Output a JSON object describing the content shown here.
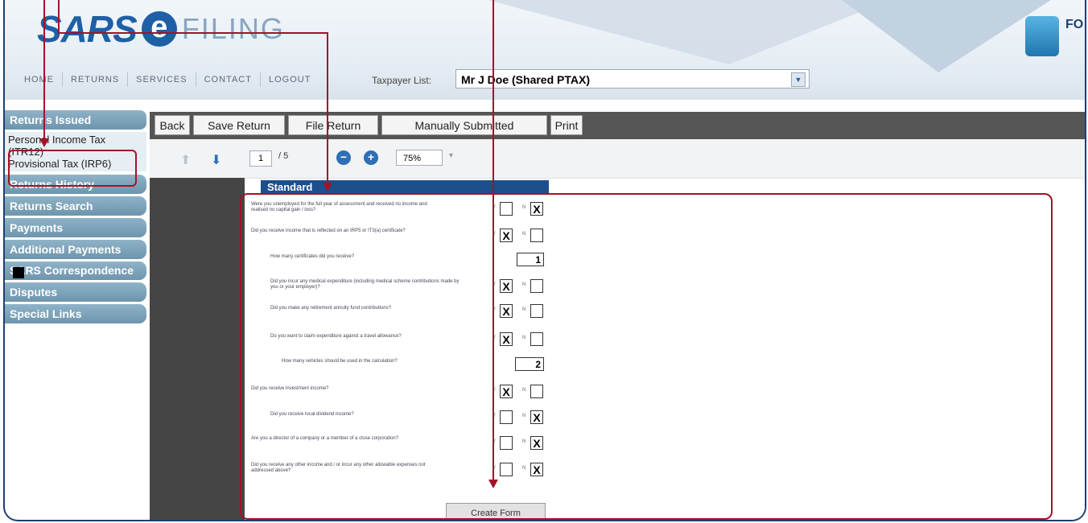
{
  "brand": {
    "sars": "SARS",
    "e": "e",
    "filing": "FILING"
  },
  "header": {
    "corner_text": "FO"
  },
  "topnav": [
    "HOME",
    "RETURNS",
    "SERVICES",
    "CONTACT",
    "LOGOUT"
  ],
  "taxpayer": {
    "label": "Taxpayer List:",
    "selected": "Mr J Doe (Shared PTAX)"
  },
  "sidebar": {
    "returns_issued": "Returns Issued",
    "returns_issued_items": [
      "Personal Income Tax",
      "(ITR12)",
      "Provisional Tax (IRP6)"
    ],
    "buttons": [
      "Returns History",
      "Returns Search",
      "Payments",
      "Additional Payments",
      "SARS Correspondence",
      "Disputes",
      "Special Links"
    ]
  },
  "toolbar": {
    "back": "Back",
    "save": "Save Return",
    "file": "File Return",
    "manual": "Manually Submitted",
    "print": "Print"
  },
  "pdf": {
    "page": "1",
    "total": "/ 5",
    "zoom": "75%"
  },
  "form": {
    "title": "Standard",
    "yes": "Y",
    "no": "N",
    "questions": [
      {
        "text": "Were you unemployed for the full year of assessment and received no income and realised no capital gain / loss?",
        "y": "",
        "n": "X"
      },
      {
        "text": "Did you receive income that is reflected on an IRP5 or IT3(a) certificate?",
        "y": "X",
        "n": ""
      },
      {
        "text": "How many certificates did you receive?",
        "count": "1"
      },
      {
        "text": "Did you incur any medical expenditure (including medical scheme contributions made by you or your employer)?",
        "y": "X",
        "n": ""
      },
      {
        "text": "Did you make any retirement annuity fund contributions?",
        "y": "X",
        "n": ""
      },
      {
        "text": "Do you want to claim expenditure against a travel allowance?",
        "y": "X",
        "n": ""
      },
      {
        "text": "How many vehicles should be used in the calculation?",
        "count": "2"
      },
      {
        "text": "Did you receive investment income?",
        "y": "X",
        "n": ""
      },
      {
        "text": "Did you receive local dividend income?",
        "y": "",
        "n": "X"
      },
      {
        "text": "Are you a director of a company or a member of a close corporation?",
        "y": "",
        "n": "X"
      },
      {
        "text": "Did you receive any other income and / or incur any other allowable expenses not addressed above?",
        "y": "",
        "n": "X"
      }
    ],
    "create_button": "Create Form"
  }
}
